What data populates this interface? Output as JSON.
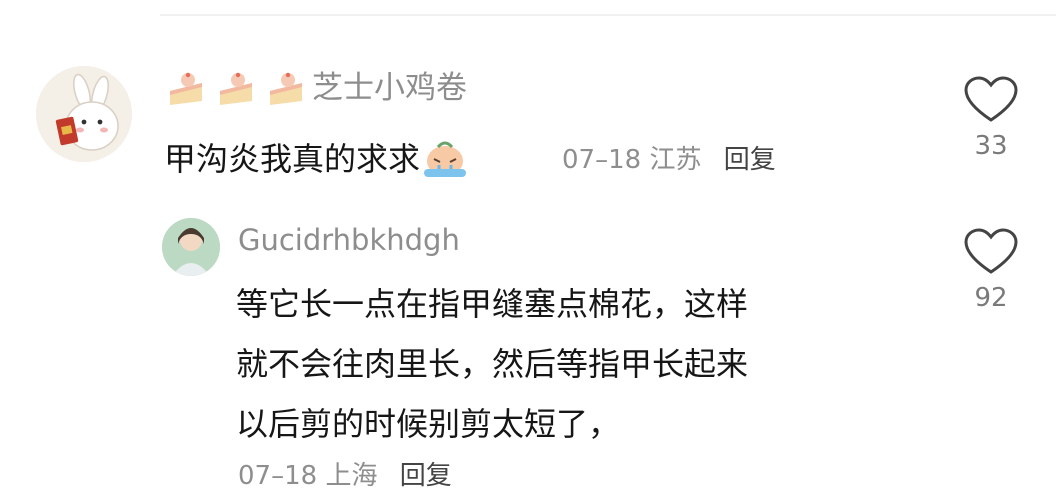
{
  "main_comment": {
    "username": "芝士小鸡卷",
    "badges": [
      "cake-icon",
      "cake-icon",
      "cake-icon"
    ],
    "text": "甲沟炎我真的求求",
    "emoji": "crying-emoji",
    "date": "07–18",
    "location": "江苏",
    "reply_label": "回复",
    "likes": "33"
  },
  "reply_comment": {
    "username": "Gucidrhbkhdgh",
    "text_lines": [
      "等它长一点在指甲缝塞点棉花，这样",
      "就不会往肉里长，然后等指甲长起来",
      "以后剪的时候别剪太短了，"
    ],
    "date": "07–18",
    "location": "上海",
    "reply_label": "回复",
    "likes": "92"
  },
  "colors": {
    "meta_gray": "#8e8e8e",
    "text_dark": "#161616",
    "heart_outline": "#444444"
  }
}
